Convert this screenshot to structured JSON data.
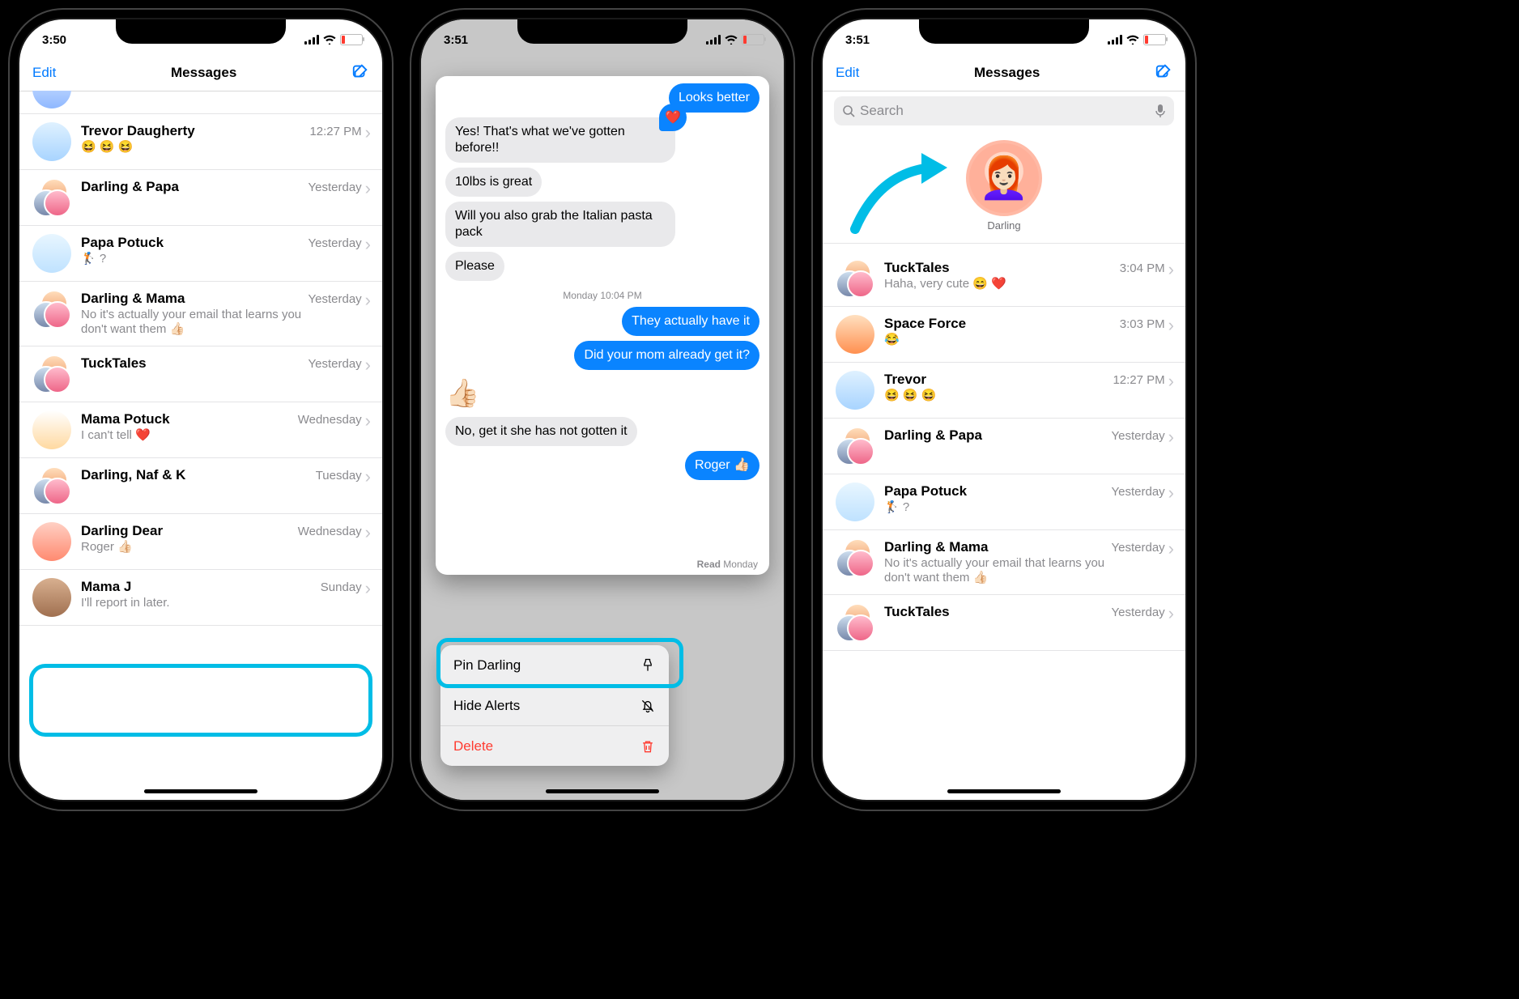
{
  "status": {
    "time1": "3:50",
    "time2": "3:51",
    "time3": "3:51"
  },
  "nav": {
    "edit": "Edit",
    "title": "Messages",
    "search_placeholder": "Search"
  },
  "screen1_rows": [
    {
      "name": "Trevor Daugherty",
      "preview": "😆 😆 😆",
      "time": "12:27 PM",
      "avatar": "linear-gradient(#dff1ff,#a8d4ff)"
    },
    {
      "name": "Darling & Papa",
      "preview": "",
      "time": "Yesterday",
      "avatar": "stack"
    },
    {
      "name": "Papa Potuck",
      "preview": "🏌️ ?",
      "time": "Yesterday",
      "avatar": "linear-gradient(#e8f6ff,#bfe2ff)"
    },
    {
      "name": "Darling & Mama",
      "preview": "No it's actually your email that learns you don't want them 👍🏻",
      "time": "Yesterday",
      "avatar": "stack"
    },
    {
      "name": "TuckTales",
      "preview": "",
      "time": "Yesterday",
      "avatar": "stack"
    },
    {
      "name": "Mama Potuck",
      "preview": "I can't tell ❤️",
      "time": "Wednesday",
      "avatar": "linear-gradient(#fff,#ffd9a0)"
    },
    {
      "name": "Darling, Naf & K",
      "preview": "",
      "time": "Tuesday",
      "avatar": "stack"
    },
    {
      "name": "Darling Dear",
      "preview": "Roger 👍🏻",
      "time": "Wednesday",
      "avatar": "linear-gradient(#ffd0c4,#ff8a70)"
    },
    {
      "name": "Mama J",
      "preview": "I'll report in later.",
      "time": "Sunday",
      "avatar": "linear-gradient(#d8b090,#a07050)"
    }
  ],
  "screen2": {
    "bubbles": [
      {
        "side": "r",
        "text": "Looks better"
      },
      {
        "side": "l",
        "text": "Yes! That's what we've gotten before!!",
        "react": "heart"
      },
      {
        "side": "l",
        "text": "10lbs is great"
      },
      {
        "side": "l",
        "text": "Will you also grab the Italian pasta pack"
      },
      {
        "side": "l",
        "text": "Please"
      }
    ],
    "timestamp": "Monday 10:04 PM",
    "bubbles2": [
      {
        "side": "r",
        "text": "They actually have it"
      },
      {
        "side": "r",
        "text": "Did your mom already get it?"
      }
    ],
    "thumbs": "👍🏻",
    "bubbles3": [
      {
        "side": "l",
        "text": "No, get it she has not gotten it"
      },
      {
        "side": "r",
        "text": "Roger 👍🏻"
      }
    ],
    "read_label": "Read",
    "read_time": "Monday",
    "menu": {
      "pin": "Pin Darling",
      "hide": "Hide Alerts",
      "delete": "Delete"
    }
  },
  "screen3": {
    "pinned_label": "Darling",
    "rows": [
      {
        "name": "TuckTales",
        "preview": "Haha, very cute 😄 ❤️",
        "time": "3:04 PM",
        "avatar": "stack"
      },
      {
        "name": "Space Force",
        "preview": "😂",
        "time": "3:03 PM",
        "avatar": "linear-gradient(#ffe0c0,#ff9050)"
      },
      {
        "name": "Trevor",
        "preview": "😆 😆 😆",
        "time": "12:27 PM",
        "avatar": "linear-gradient(#dff1ff,#a8d4ff)"
      },
      {
        "name": "Darling & Papa",
        "preview": "",
        "time": "Yesterday",
        "avatar": "stack"
      },
      {
        "name": "Papa Potuck",
        "preview": "🏌️ ?",
        "time": "Yesterday",
        "avatar": "linear-gradient(#e8f6ff,#bfe2ff)"
      },
      {
        "name": "Darling & Mama",
        "preview": "No it's actually your email that learns you don't want them 👍🏻",
        "time": "Yesterday",
        "avatar": "stack"
      },
      {
        "name": "TuckTales",
        "preview": "",
        "time": "Yesterday",
        "avatar": "stack"
      }
    ]
  }
}
